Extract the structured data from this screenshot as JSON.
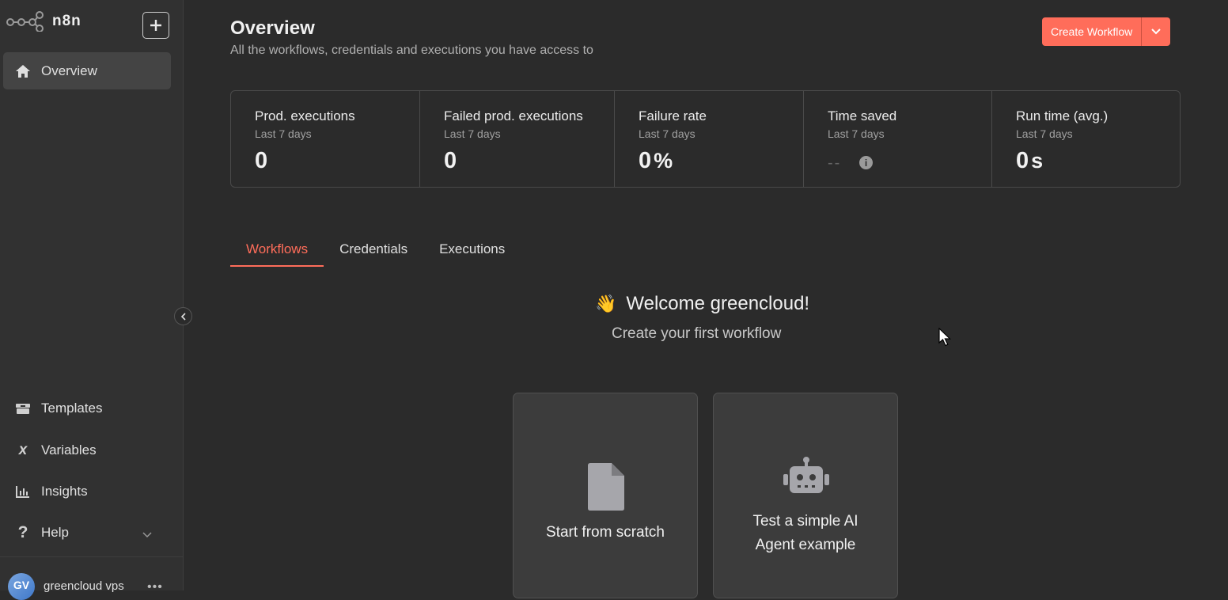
{
  "app": {
    "name": "n8n"
  },
  "sidebar": {
    "overview_label": "Overview",
    "items": [
      {
        "label": "Templates",
        "icon": "templates-icon"
      },
      {
        "label": "Variables",
        "icon": "variables-icon"
      },
      {
        "label": "Insights",
        "icon": "insights-icon"
      },
      {
        "label": "Help",
        "icon": "help-icon"
      }
    ],
    "user": {
      "initials": "GV",
      "name": "greencloud vps"
    }
  },
  "header": {
    "title": "Overview",
    "subtitle": "All the workflows, credentials and executions you have access to",
    "create_button": "Create Workflow"
  },
  "stats": [
    {
      "title": "Prod. executions",
      "period": "Last 7 days",
      "value": "0"
    },
    {
      "title": "Failed prod. executions",
      "period": "Last 7 days",
      "value": "0"
    },
    {
      "title": "Failure rate",
      "period": "Last 7 days",
      "value": "0",
      "unit": "%"
    },
    {
      "title": "Time saved",
      "period": "Last 7 days",
      "value": "--"
    },
    {
      "title": "Run time (avg.)",
      "period": "Last 7 days",
      "value": "0",
      "unit": "s"
    }
  ],
  "tabs": [
    {
      "label": "Workflows",
      "active": true
    },
    {
      "label": "Credentials",
      "active": false
    },
    {
      "label": "Executions",
      "active": false
    }
  ],
  "empty_state": {
    "welcome": "Welcome greencloud!",
    "subtitle": "Create your first workflow",
    "cards": [
      {
        "label": "Start from scratch",
        "icon": "file-icon"
      },
      {
        "label_line1": "Test a simple AI",
        "label_line2": "Agent example",
        "icon": "robot-icon"
      }
    ]
  },
  "colors": {
    "accent": "#ff6d5a",
    "background": "#2b2b2b",
    "sidebar": "#313131"
  }
}
